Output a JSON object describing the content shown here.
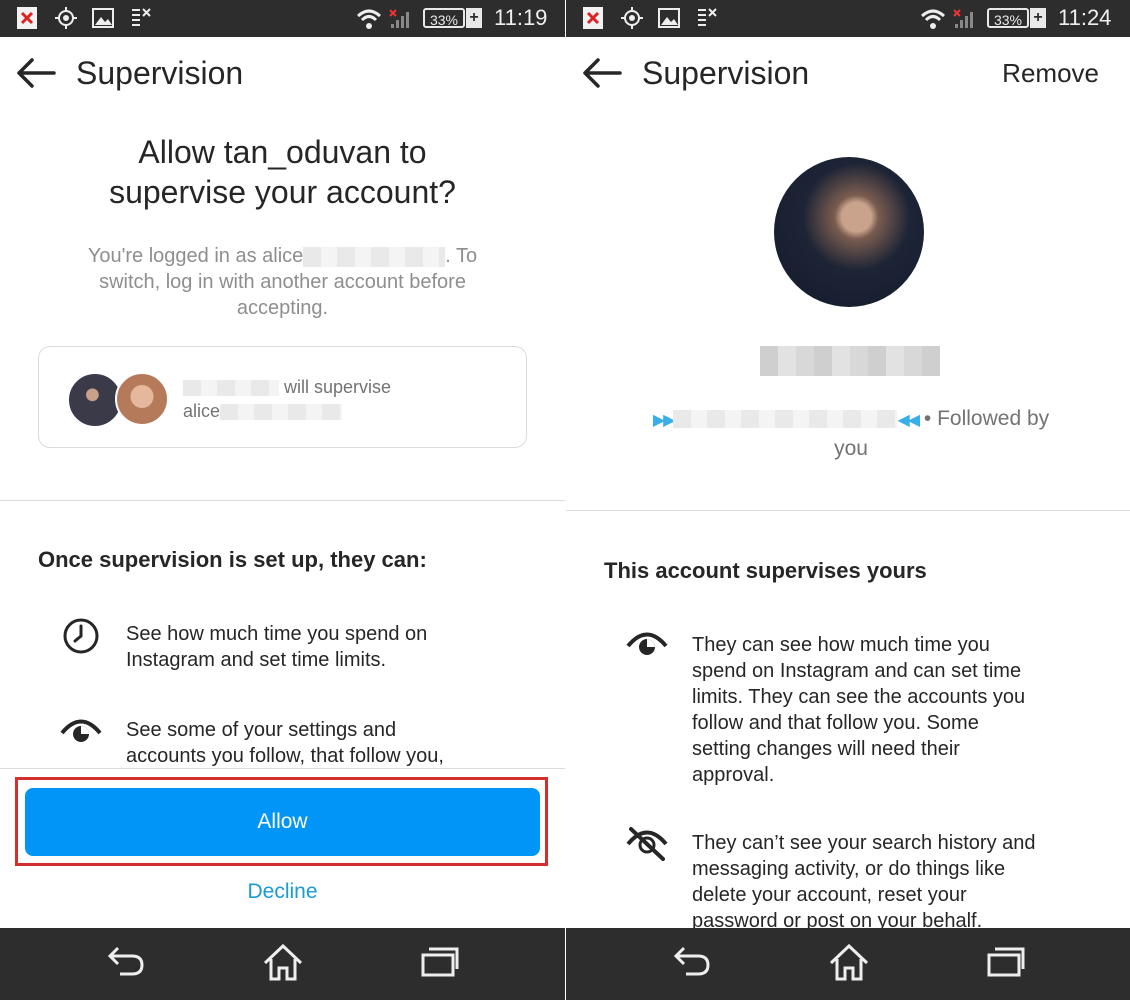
{
  "left": {
    "status": {
      "battery": "33%",
      "time": "11:19"
    },
    "header": {
      "title": "Supervision"
    },
    "question": {
      "line1": "Allow tan_oduvan to",
      "line2": "supervise your account?"
    },
    "logged_in": {
      "prefix": "You're logged in as alice",
      "suffix": ". To",
      "line2": "switch, log in with another account before",
      "line3": "accepting."
    },
    "card": {
      "supervise_text": "will supervise",
      "account": "alice"
    },
    "section_heading": "Once supervision is set up, they can:",
    "permissions": [
      {
        "icon": "clock-icon",
        "line1": "See how much time you spend on",
        "line2": "Instagram and set time limits."
      },
      {
        "icon": "eye-icon",
        "line1": "See some of your settings and",
        "line2": "accounts you follow, that follow you,"
      }
    ],
    "allow_label": "Allow",
    "decline_label": "Decline"
  },
  "right": {
    "status": {
      "battery": "33%",
      "time": "11:24"
    },
    "header": {
      "title": "Supervision",
      "remove_label": "Remove"
    },
    "follow_text": "• Followed by",
    "follow_line2": "you",
    "section_heading": "This account supervises yours",
    "permissions": [
      {
        "icon": "eye-icon",
        "lines": [
          "They can see how much time you",
          "spend on Instagram and can set time",
          "limits. They can see the accounts you",
          "follow and that follow you. Some",
          "setting changes will need their",
          "approval."
        ]
      },
      {
        "icon": "eye-off-icon",
        "lines": [
          "They can’t see your search history and",
          "messaging activity, or do things like",
          "delete your account, reset your",
          "password or post on your behalf."
        ]
      }
    ]
  },
  "colors": {
    "primary": "#0095f6",
    "highlight": "#d32f2f",
    "bar": "#2d2d2d",
    "link": "#1a9bd1"
  }
}
